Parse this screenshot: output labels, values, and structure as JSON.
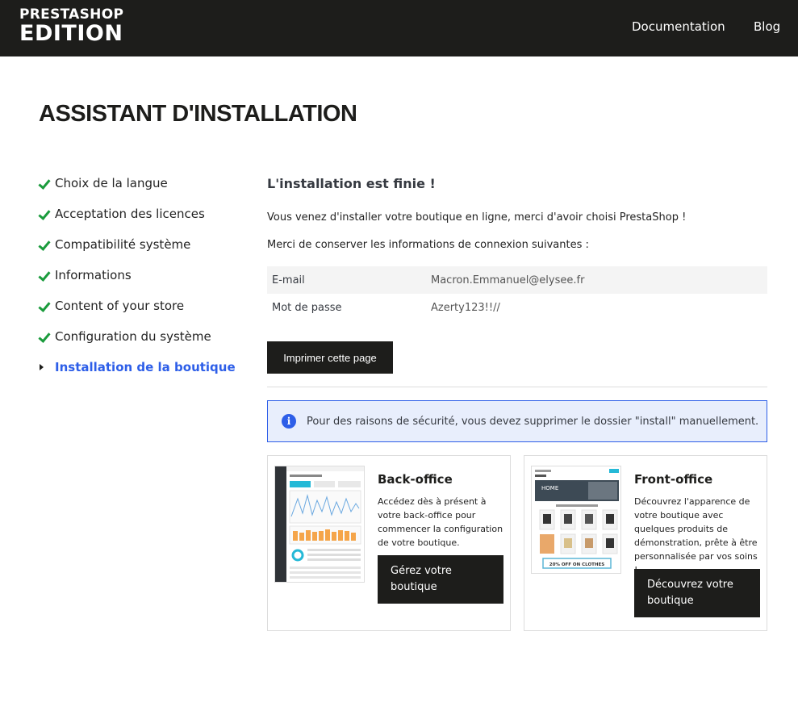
{
  "header": {
    "logo_line1": "PRESTASHOP",
    "logo_line2": "EDITION",
    "nav": [
      "Documentation",
      "Blog"
    ]
  },
  "page_title": "ASSISTANT D'INSTALLATION",
  "steps": [
    {
      "label": "Choix de la langue",
      "status": "done"
    },
    {
      "label": "Acceptation des licences",
      "status": "done"
    },
    {
      "label": "Compatibilité système",
      "status": "done"
    },
    {
      "label": "Informations",
      "status": "done"
    },
    {
      "label": "Content of your store",
      "status": "done"
    },
    {
      "label": "Configuration du système",
      "status": "done"
    },
    {
      "label": "Installation de la boutique",
      "status": "active"
    }
  ],
  "main": {
    "title": "L'installation est finie !",
    "intro": "Vous venez d'installer votre boutique en ligne, merci d'avoir choisi PrestaShop !",
    "keep_info": "Merci de conserver les informations de connexion suivantes :",
    "credentials": [
      {
        "label": "E-mail",
        "value": "Macron.Emmanuel@elysee.fr"
      },
      {
        "label": "Mot de passe",
        "value": "Azerty123!!//"
      }
    ],
    "print_button": "Imprimer cette page",
    "alert": "Pour des raisons de sécurité, vous devez supprimer le dossier \"install\" manuellement.",
    "back_office": {
      "title": "Back-office",
      "description": "Accédez dès à présent à votre back-office pour commencer la configuration de votre boutique.",
      "button": "Gérez votre boutique"
    },
    "front_office": {
      "title": "Front-office",
      "description": "Découvrez l'apparence de votre boutique avec quelques produits de démonstration, prête à être personnalisée par vos soins !",
      "button": "Découvrez votre boutique",
      "banner_home": "HOME",
      "banner_promo": "20% OFF ON CLOTHES"
    }
  },
  "colors": {
    "header_bg": "#1d1d1b",
    "accent_blue": "#2d5ee8",
    "check_green": "#1a9b3c",
    "alert_bg": "#e8eefc"
  }
}
